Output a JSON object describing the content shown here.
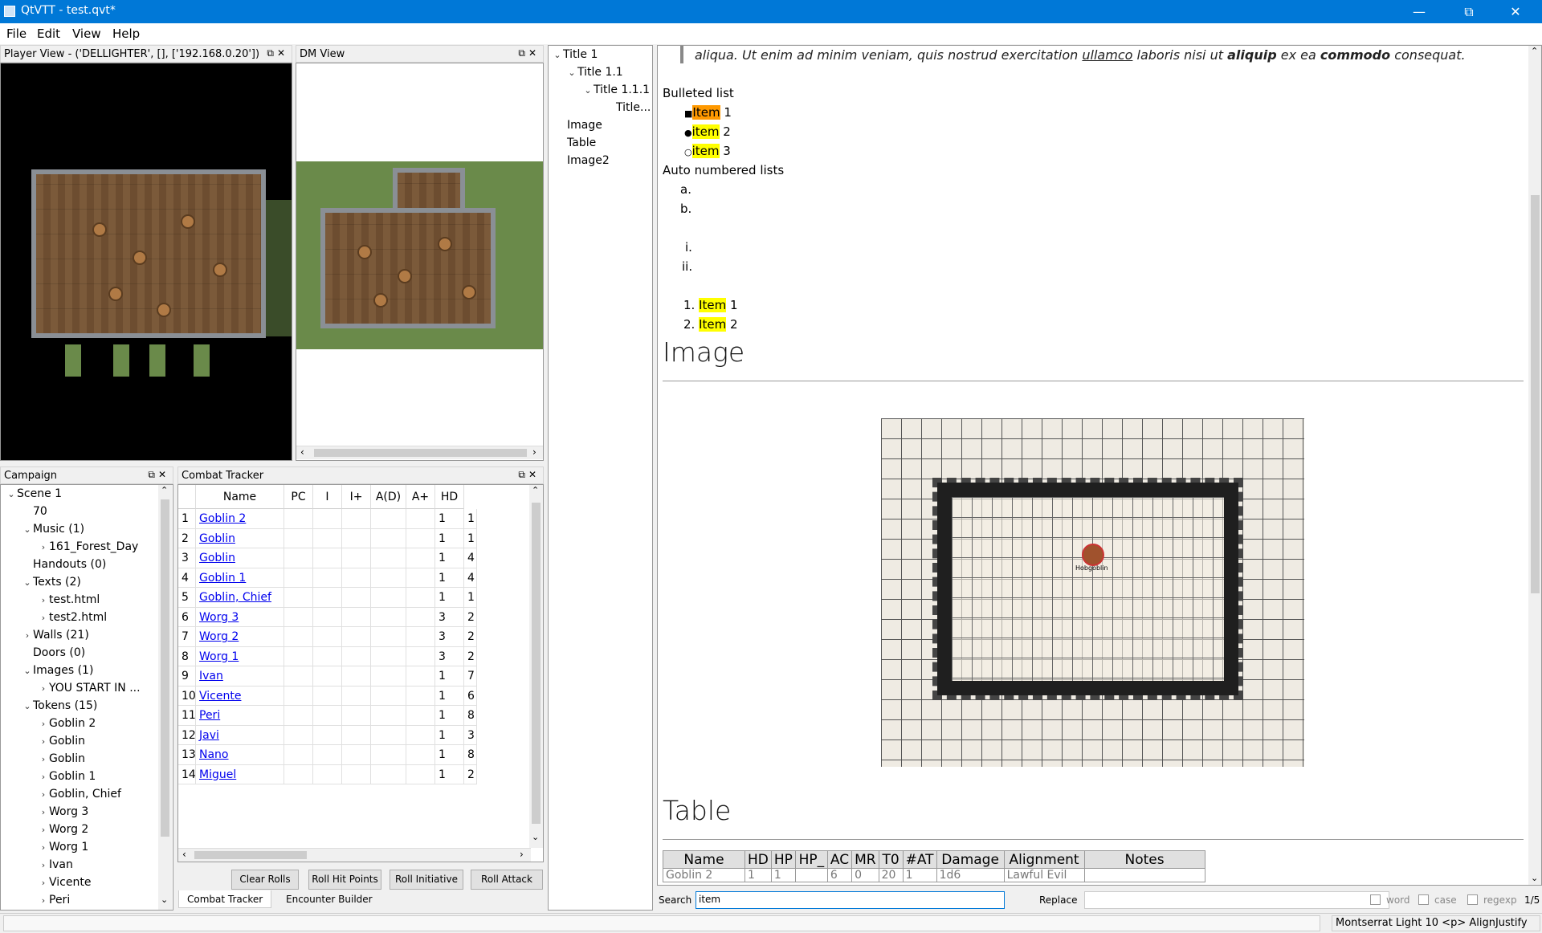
{
  "window": {
    "title": "QtVTT - test.qvt*"
  },
  "menu": [
    "File",
    "Edit",
    "View",
    "Help"
  ],
  "player_view": {
    "title": "Player View - ('DELLIGHTER', [], ['192.168.0.20'])"
  },
  "dm_view": {
    "title": "DM View"
  },
  "outline": [
    "Title 1",
    "Title 1.1",
    "Title 1.1.1",
    "Title...",
    "Image",
    "Table",
    "Image2"
  ],
  "campaign": {
    "title": "Campaign",
    "items": [
      {
        "label": "Scene 1",
        "level": 0,
        "chev": "down"
      },
      {
        "label": "70",
        "level": 1,
        "chev": ""
      },
      {
        "label": "Music (1)",
        "level": 1,
        "chev": "down"
      },
      {
        "label": "161_Forest_Day",
        "level": 2,
        "chev": "right"
      },
      {
        "label": "Handouts (0)",
        "level": 1,
        "chev": ""
      },
      {
        "label": "Texts (2)",
        "level": 1,
        "chev": "down"
      },
      {
        "label": "test.html",
        "level": 2,
        "chev": "right"
      },
      {
        "label": "test2.html",
        "level": 2,
        "chev": "right"
      },
      {
        "label": "Walls (21)",
        "level": 1,
        "chev": "right"
      },
      {
        "label": "Doors (0)",
        "level": 1,
        "chev": ""
      },
      {
        "label": "Images (1)",
        "level": 1,
        "chev": "down"
      },
      {
        "label": "YOU START IN ...",
        "level": 2,
        "chev": "right"
      },
      {
        "label": "Tokens (15)",
        "level": 1,
        "chev": "down"
      },
      {
        "label": "Goblin 2",
        "level": 2,
        "chev": "right"
      },
      {
        "label": "Goblin",
        "level": 2,
        "chev": "right"
      },
      {
        "label": "Goblin",
        "level": 2,
        "chev": "right"
      },
      {
        "label": "Goblin 1",
        "level": 2,
        "chev": "right"
      },
      {
        "label": "Goblin, Chief",
        "level": 2,
        "chev": "right"
      },
      {
        "label": "Worg 3",
        "level": 2,
        "chev": "right"
      },
      {
        "label": "Worg 2",
        "level": 2,
        "chev": "right"
      },
      {
        "label": "Worg 1",
        "level": 2,
        "chev": "right"
      },
      {
        "label": "Ivan",
        "level": 2,
        "chev": "right"
      },
      {
        "label": "Vicente",
        "level": 2,
        "chev": "right"
      },
      {
        "label": "Peri",
        "level": 2,
        "chev": "right"
      }
    ]
  },
  "combat": {
    "title": "Combat Tracker",
    "headers": [
      "Name",
      "PC",
      "I",
      "I+",
      "A(D)",
      "A+",
      "HD"
    ],
    "rows": [
      {
        "n": "1",
        "name": "Goblin 2",
        "hd": "1",
        "extra": "1"
      },
      {
        "n": "2",
        "name": "Goblin",
        "hd": "1",
        "extra": "1"
      },
      {
        "n": "3",
        "name": "Goblin",
        "hd": "1",
        "extra": "4"
      },
      {
        "n": "4",
        "name": "Goblin 1",
        "hd": "1",
        "extra": "4"
      },
      {
        "n": "5",
        "name": "Goblin, Chief",
        "hd": "1",
        "extra": "1"
      },
      {
        "n": "6",
        "name": "Worg 3",
        "hd": "3",
        "extra": "2"
      },
      {
        "n": "7",
        "name": "Worg 2",
        "hd": "3",
        "extra": "2"
      },
      {
        "n": "8",
        "name": "Worg 1",
        "hd": "3",
        "extra": "2"
      },
      {
        "n": "9",
        "name": "Ivan",
        "hd": "1",
        "extra": "7"
      },
      {
        "n": "10",
        "name": "Vicente",
        "hd": "1",
        "extra": "6"
      },
      {
        "n": "11",
        "name": "Peri",
        "hd": "1",
        "extra": "8"
      },
      {
        "n": "12",
        "name": "Javi",
        "hd": "1",
        "extra": "3"
      },
      {
        "n": "13",
        "name": "Nano",
        "hd": "1",
        "extra": "8"
      },
      {
        "n": "14",
        "name": "Miguel",
        "hd": "1",
        "extra": "2"
      }
    ],
    "buttons": [
      "Clear Rolls",
      "Roll Hit Points",
      "Roll Initiative",
      "Roll Attack"
    ],
    "tabs": [
      "Combat Tracker",
      "Encounter Builder"
    ]
  },
  "doc": {
    "quote": {
      "a": "aliqua. Ut enim ad minim veniam, quis nostrud exercitation ",
      "u": "ullamco",
      "b": " laboris nisi ut ",
      "bold1": "aliquip",
      "c": " ex ea ",
      "bold2": "commodo",
      "d": " consequat."
    },
    "bulleted_title": "Bulleted list",
    "bullets": [
      {
        "mark": "■",
        "hl": "Item",
        "rest": " 1",
        "current": true
      },
      {
        "mark": "●",
        "hl": "item",
        "rest": " 2",
        "current": false
      },
      {
        "mark": "○",
        "hl": "item",
        "rest": " 3",
        "current": false
      }
    ],
    "auto_title": "Auto numbered lists",
    "alpha": [
      "a.",
      "b."
    ],
    "roman": [
      "i.",
      "ii."
    ],
    "numbered": [
      {
        "n": "1.",
        "hl": "Item",
        "rest": " 1"
      },
      {
        "n": "2.",
        "hl": "Item",
        "rest": " 2"
      }
    ],
    "image_heading": "Image",
    "token_label": "Hobgoblin",
    "table_heading": "Table",
    "table_headers": [
      "Name",
      "HD",
      "HP",
      "HP_",
      "AC",
      "MR",
      "T0",
      "#AT",
      "Damage",
      "Alignment",
      "Notes"
    ],
    "table_row": [
      "Goblin 2",
      "1",
      "1",
      "",
      "6",
      "0",
      "20",
      "1",
      "1d6",
      "Lawful Evil",
      ""
    ]
  },
  "search": {
    "label": "Search",
    "value": "item",
    "replace_label": "Replace",
    "options": [
      "word",
      "case",
      "regexp"
    ],
    "count": "1/5"
  },
  "status": {
    "right": "Montserrat Light 10 <p> AlignJustify"
  }
}
